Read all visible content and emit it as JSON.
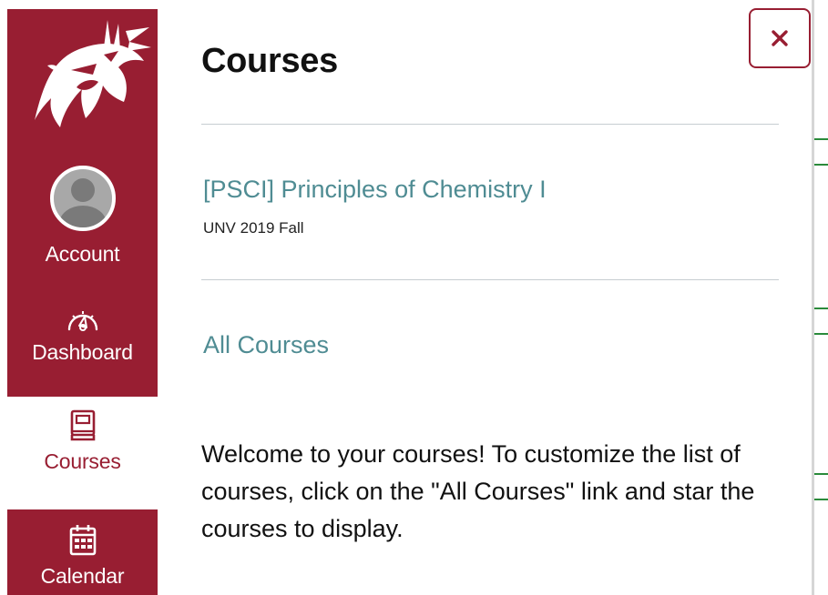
{
  "nav": {
    "brand_logo": "wsu-cougar-logo",
    "items": [
      {
        "label": "Account",
        "icon": "avatar-icon",
        "active": false
      },
      {
        "label": "Dashboard",
        "icon": "speedometer-icon",
        "active": false
      },
      {
        "label": "Courses",
        "icon": "book-icon",
        "active": true
      },
      {
        "label": "Calendar",
        "icon": "calendar-icon",
        "active": false
      }
    ]
  },
  "tray": {
    "title": "Courses",
    "close_icon": "close-icon",
    "courses": [
      {
        "name": "[PSCI] Principles of Chemistry I",
        "term": "UNV 2019 Fall"
      }
    ],
    "all_courses_label": "All Courses",
    "welcome_message": "Welcome to your courses! To customize the list of courses, click on the \"All Courses\" link and star the courses to display."
  },
  "colors": {
    "brand_crimson": "#981e32",
    "link_teal": "#4f8c93",
    "divider_gray": "#c7cdd1"
  }
}
